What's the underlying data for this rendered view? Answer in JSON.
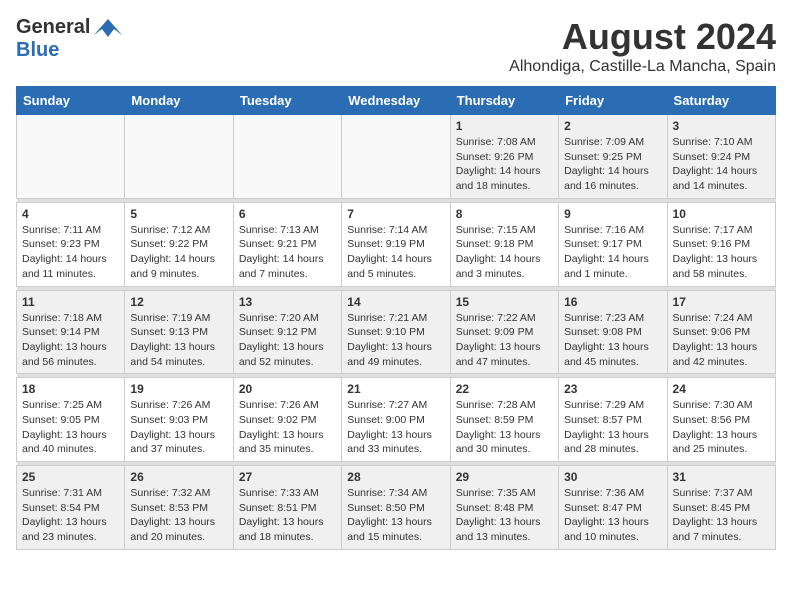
{
  "header": {
    "logo_general": "General",
    "logo_blue": "Blue",
    "month_year": "August 2024",
    "location": "Alhondiga, Castille-La Mancha, Spain"
  },
  "weekdays": [
    "Sunday",
    "Monday",
    "Tuesday",
    "Wednesday",
    "Thursday",
    "Friday",
    "Saturday"
  ],
  "weeks": [
    [
      {
        "day": "",
        "info": ""
      },
      {
        "day": "",
        "info": ""
      },
      {
        "day": "",
        "info": ""
      },
      {
        "day": "",
        "info": ""
      },
      {
        "day": "1",
        "info": "Sunrise: 7:08 AM\nSunset: 9:26 PM\nDaylight: 14 hours\nand 18 minutes."
      },
      {
        "day": "2",
        "info": "Sunrise: 7:09 AM\nSunset: 9:25 PM\nDaylight: 14 hours\nand 16 minutes."
      },
      {
        "day": "3",
        "info": "Sunrise: 7:10 AM\nSunset: 9:24 PM\nDaylight: 14 hours\nand 14 minutes."
      }
    ],
    [
      {
        "day": "4",
        "info": "Sunrise: 7:11 AM\nSunset: 9:23 PM\nDaylight: 14 hours\nand 11 minutes."
      },
      {
        "day": "5",
        "info": "Sunrise: 7:12 AM\nSunset: 9:22 PM\nDaylight: 14 hours\nand 9 minutes."
      },
      {
        "day": "6",
        "info": "Sunrise: 7:13 AM\nSunset: 9:21 PM\nDaylight: 14 hours\nand 7 minutes."
      },
      {
        "day": "7",
        "info": "Sunrise: 7:14 AM\nSunset: 9:19 PM\nDaylight: 14 hours\nand 5 minutes."
      },
      {
        "day": "8",
        "info": "Sunrise: 7:15 AM\nSunset: 9:18 PM\nDaylight: 14 hours\nand 3 minutes."
      },
      {
        "day": "9",
        "info": "Sunrise: 7:16 AM\nSunset: 9:17 PM\nDaylight: 14 hours\nand 1 minute."
      },
      {
        "day": "10",
        "info": "Sunrise: 7:17 AM\nSunset: 9:16 PM\nDaylight: 13 hours\nand 58 minutes."
      }
    ],
    [
      {
        "day": "11",
        "info": "Sunrise: 7:18 AM\nSunset: 9:14 PM\nDaylight: 13 hours\nand 56 minutes."
      },
      {
        "day": "12",
        "info": "Sunrise: 7:19 AM\nSunset: 9:13 PM\nDaylight: 13 hours\nand 54 minutes."
      },
      {
        "day": "13",
        "info": "Sunrise: 7:20 AM\nSunset: 9:12 PM\nDaylight: 13 hours\nand 52 minutes."
      },
      {
        "day": "14",
        "info": "Sunrise: 7:21 AM\nSunset: 9:10 PM\nDaylight: 13 hours\nand 49 minutes."
      },
      {
        "day": "15",
        "info": "Sunrise: 7:22 AM\nSunset: 9:09 PM\nDaylight: 13 hours\nand 47 minutes."
      },
      {
        "day": "16",
        "info": "Sunrise: 7:23 AM\nSunset: 9:08 PM\nDaylight: 13 hours\nand 45 minutes."
      },
      {
        "day": "17",
        "info": "Sunrise: 7:24 AM\nSunset: 9:06 PM\nDaylight: 13 hours\nand 42 minutes."
      }
    ],
    [
      {
        "day": "18",
        "info": "Sunrise: 7:25 AM\nSunset: 9:05 PM\nDaylight: 13 hours\nand 40 minutes."
      },
      {
        "day": "19",
        "info": "Sunrise: 7:26 AM\nSunset: 9:03 PM\nDaylight: 13 hours\nand 37 minutes."
      },
      {
        "day": "20",
        "info": "Sunrise: 7:26 AM\nSunset: 9:02 PM\nDaylight: 13 hours\nand 35 minutes."
      },
      {
        "day": "21",
        "info": "Sunrise: 7:27 AM\nSunset: 9:00 PM\nDaylight: 13 hours\nand 33 minutes."
      },
      {
        "day": "22",
        "info": "Sunrise: 7:28 AM\nSunset: 8:59 PM\nDaylight: 13 hours\nand 30 minutes."
      },
      {
        "day": "23",
        "info": "Sunrise: 7:29 AM\nSunset: 8:57 PM\nDaylight: 13 hours\nand 28 minutes."
      },
      {
        "day": "24",
        "info": "Sunrise: 7:30 AM\nSunset: 8:56 PM\nDaylight: 13 hours\nand 25 minutes."
      }
    ],
    [
      {
        "day": "25",
        "info": "Sunrise: 7:31 AM\nSunset: 8:54 PM\nDaylight: 13 hours\nand 23 minutes."
      },
      {
        "day": "26",
        "info": "Sunrise: 7:32 AM\nSunset: 8:53 PM\nDaylight: 13 hours\nand 20 minutes."
      },
      {
        "day": "27",
        "info": "Sunrise: 7:33 AM\nSunset: 8:51 PM\nDaylight: 13 hours\nand 18 minutes."
      },
      {
        "day": "28",
        "info": "Sunrise: 7:34 AM\nSunset: 8:50 PM\nDaylight: 13 hours\nand 15 minutes."
      },
      {
        "day": "29",
        "info": "Sunrise: 7:35 AM\nSunset: 8:48 PM\nDaylight: 13 hours\nand 13 minutes."
      },
      {
        "day": "30",
        "info": "Sunrise: 7:36 AM\nSunset: 8:47 PM\nDaylight: 13 hours\nand 10 minutes."
      },
      {
        "day": "31",
        "info": "Sunrise: 7:37 AM\nSunset: 8:45 PM\nDaylight: 13 hours\nand 7 minutes."
      }
    ]
  ]
}
